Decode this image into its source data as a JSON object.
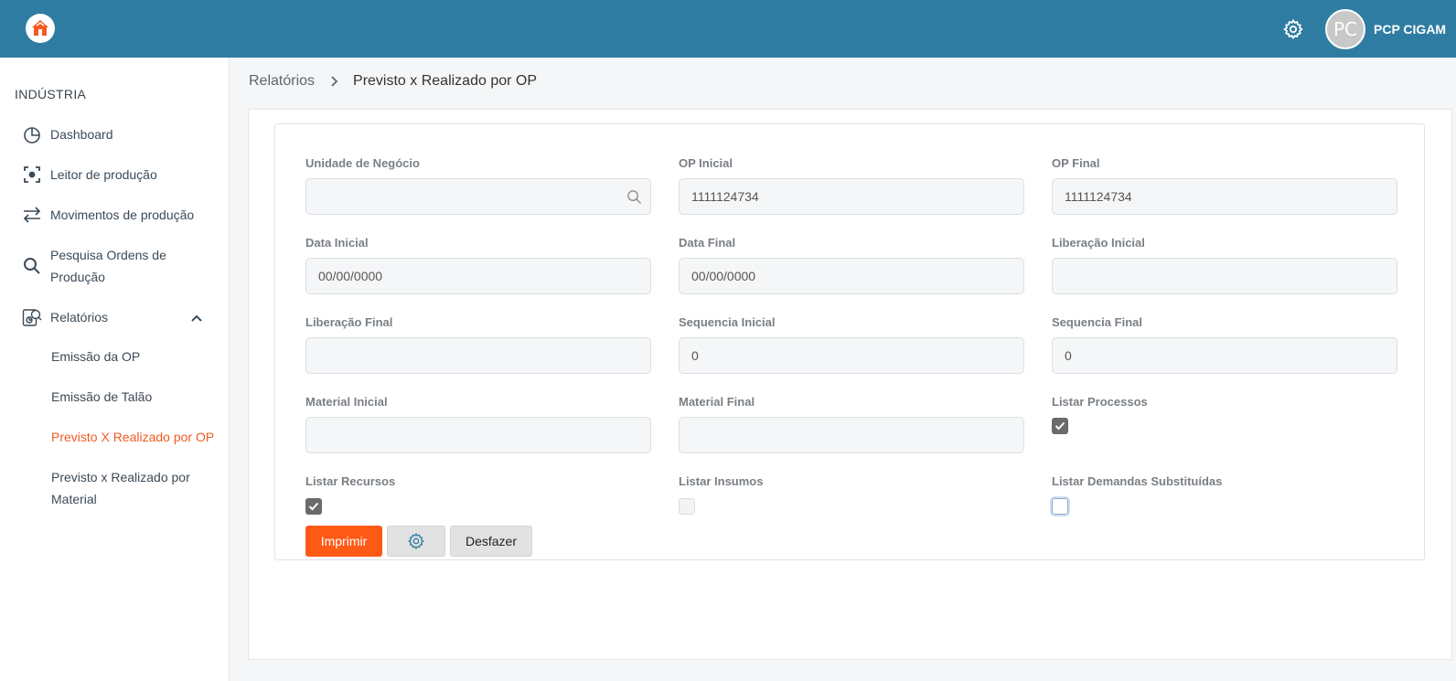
{
  "header": {
    "user_initials": "PC",
    "user_name": "PCP CIGAM"
  },
  "sidebar": {
    "section": "INDÚSTRIA",
    "items": [
      {
        "label": "Dashboard",
        "icon": "pie-chart-icon"
      },
      {
        "label": "Leitor de produção",
        "icon": "scanner-icon"
      },
      {
        "label": "Movimentos de produção",
        "icon": "swap-arrows-icon"
      },
      {
        "label_line1": "Pesquisa Ordens de",
        "label_line2": "Produção",
        "icon": "search-icon"
      },
      {
        "label": "Relatórios",
        "icon": "reports-icon"
      }
    ],
    "sub_items": [
      {
        "label": "Emissão da OP"
      },
      {
        "label": "Emissão de Talão"
      },
      {
        "label": "Previsto X Realizado por OP"
      },
      {
        "label_line1": "Previsto x Realizado por",
        "label_line2": "Material"
      }
    ]
  },
  "breadcrumb": {
    "parent": "Relatórios",
    "current": "Previsto x Realizado por OP"
  },
  "form": {
    "fields": [
      {
        "label": "Unidade de Negócio",
        "value": ""
      },
      {
        "label": "OP Inicial",
        "value": "1111124734"
      },
      {
        "label": "OP Final",
        "value": "1111124734"
      },
      {
        "label": "Data Inicial",
        "value": "00/00/0000"
      },
      {
        "label": "Data Final",
        "value": "00/00/0000"
      },
      {
        "label": "Liberação Inicial",
        "value": ""
      },
      {
        "label": "Liberação Final",
        "value": ""
      },
      {
        "label": "Sequencia Inicial",
        "value": "0"
      },
      {
        "label": "Sequencia Final",
        "value": "0"
      },
      {
        "label": "Material Inicial",
        "value": ""
      },
      {
        "label": "Material Final",
        "value": ""
      }
    ],
    "checkboxes": [
      {
        "label": "Listar Processos",
        "checked": true
      },
      {
        "label": "Listar Recursos",
        "checked": true
      },
      {
        "label": "Listar Insumos",
        "checked": false,
        "disabled": true
      },
      {
        "label": "Listar Demandas Substituídas",
        "checked": false,
        "focused": true
      }
    ],
    "buttons": {
      "print_label": "Imprimir",
      "undo_label": "Desfazer"
    }
  },
  "colors": {
    "topbar": "#2f7ca2",
    "accent": "#fe5a16",
    "active_menu": "#f15a22"
  }
}
